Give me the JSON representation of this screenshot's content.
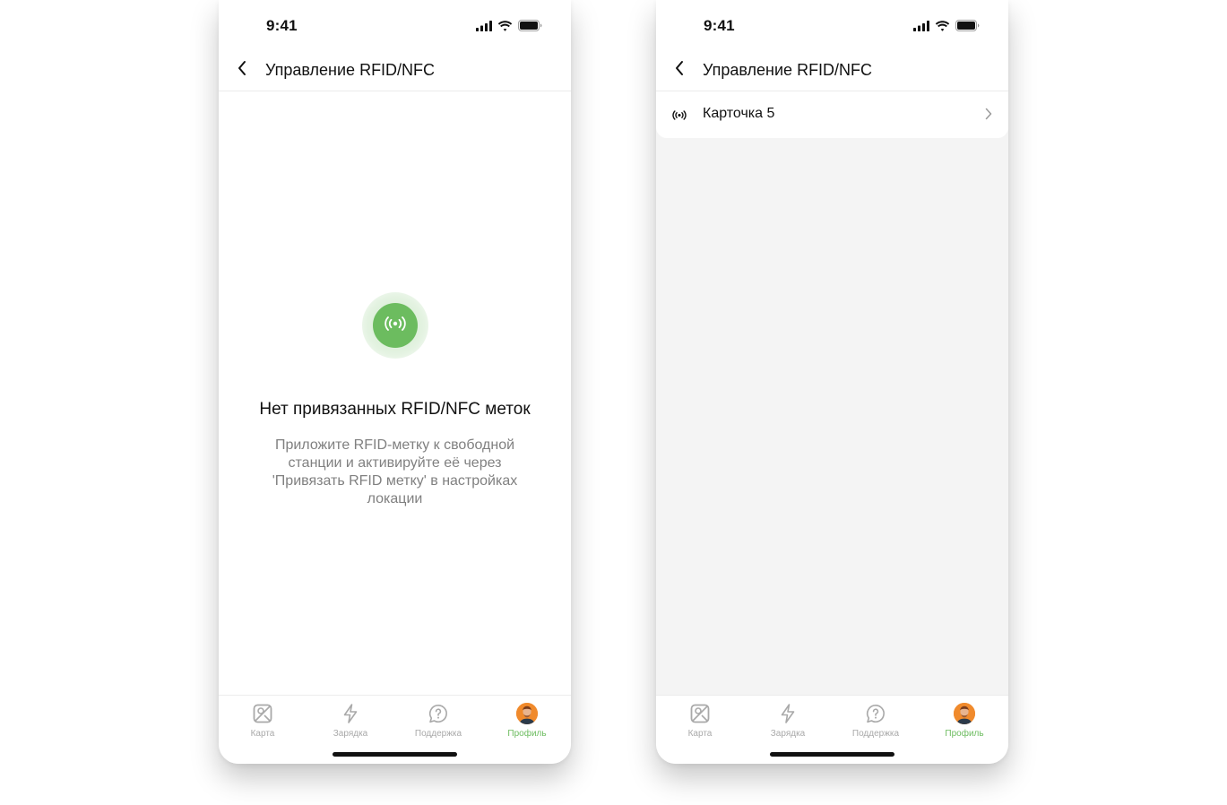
{
  "colors": {
    "accent": "#6cbc5f",
    "inactive": "#a9a9a9",
    "text": "#111111",
    "muted": "#808080"
  },
  "screens": [
    {
      "status": {
        "time": "9:41"
      },
      "nav": {
        "title": "Управление RFID/NFC",
        "back_icon": "chevron-left-icon"
      },
      "empty": {
        "icon": "rfid-signal-icon",
        "title": "Нет привязанных RFID/NFC меток",
        "description": "Приложите RFID-метку к свободной станции и активируйте её через 'Привязать RFID метку' в настройках локации"
      },
      "tabs": [
        {
          "label": "Карта",
          "icon": "map-icon",
          "active": false
        },
        {
          "label": "Зарядка",
          "icon": "lightning-icon",
          "active": false
        },
        {
          "label": "Поддержка",
          "icon": "help-chat-icon",
          "active": false
        },
        {
          "label": "Профиль",
          "icon": "avatar",
          "active": true
        }
      ]
    },
    {
      "status": {
        "time": "9:41"
      },
      "nav": {
        "title": "Управление RFID/NFC",
        "back_icon": "chevron-left-icon"
      },
      "cards": [
        {
          "label": "Карточка 5",
          "icon": "rfid-signal-icon"
        }
      ],
      "tabs": [
        {
          "label": "Карта",
          "icon": "map-icon",
          "active": false
        },
        {
          "label": "Зарядка",
          "icon": "lightning-icon",
          "active": false
        },
        {
          "label": "Поддержка",
          "icon": "help-chat-icon",
          "active": false
        },
        {
          "label": "Профиль",
          "icon": "avatar",
          "active": true
        }
      ]
    }
  ]
}
